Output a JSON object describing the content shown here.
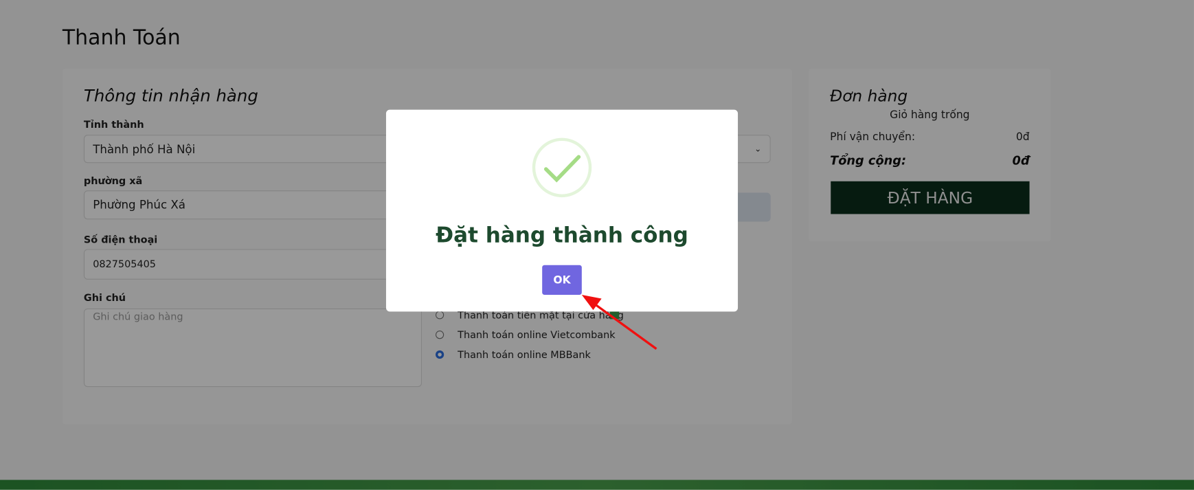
{
  "page": {
    "title": "Thanh Toán"
  },
  "shipping_form": {
    "heading": "Thông tin nhận hàng",
    "province_label": "Tỉnh thành",
    "province_value": "Thành phố Hà Nội",
    "ward_label": "phường xã",
    "ward_value": "Phường Phúc Xá",
    "phone_label": "Số điện thoại",
    "phone_value": "0827505405",
    "note_label": "Ghi chú",
    "note_placeholder": "Ghi chú giao hàng"
  },
  "payment_methods": [
    {
      "label": "Thanh toán tiền mặt tại cửa hàng",
      "selected": false
    },
    {
      "label": "Thanh toán online Vietcombank",
      "selected": false
    },
    {
      "label": "Thanh toán online MBBank",
      "selected": true
    }
  ],
  "order": {
    "heading": "Đơn hàng",
    "empty_text": "Giỏ hàng trống",
    "shipping_label": "Phí vận chuyển:",
    "shipping_value": "0đ",
    "total_label": "Tổng cộng:",
    "total_value": "0đ",
    "place_order_label": "ĐẶT HÀNG"
  },
  "modal": {
    "icon": "success-check-icon",
    "title": "Đặt hàng thành công",
    "ok_label": "OK"
  },
  "colors": {
    "ok_button": "#7066e0",
    "success": "#a5dc86",
    "modal_title": "#1d4a2e",
    "order_button": "#0b2e1c"
  }
}
